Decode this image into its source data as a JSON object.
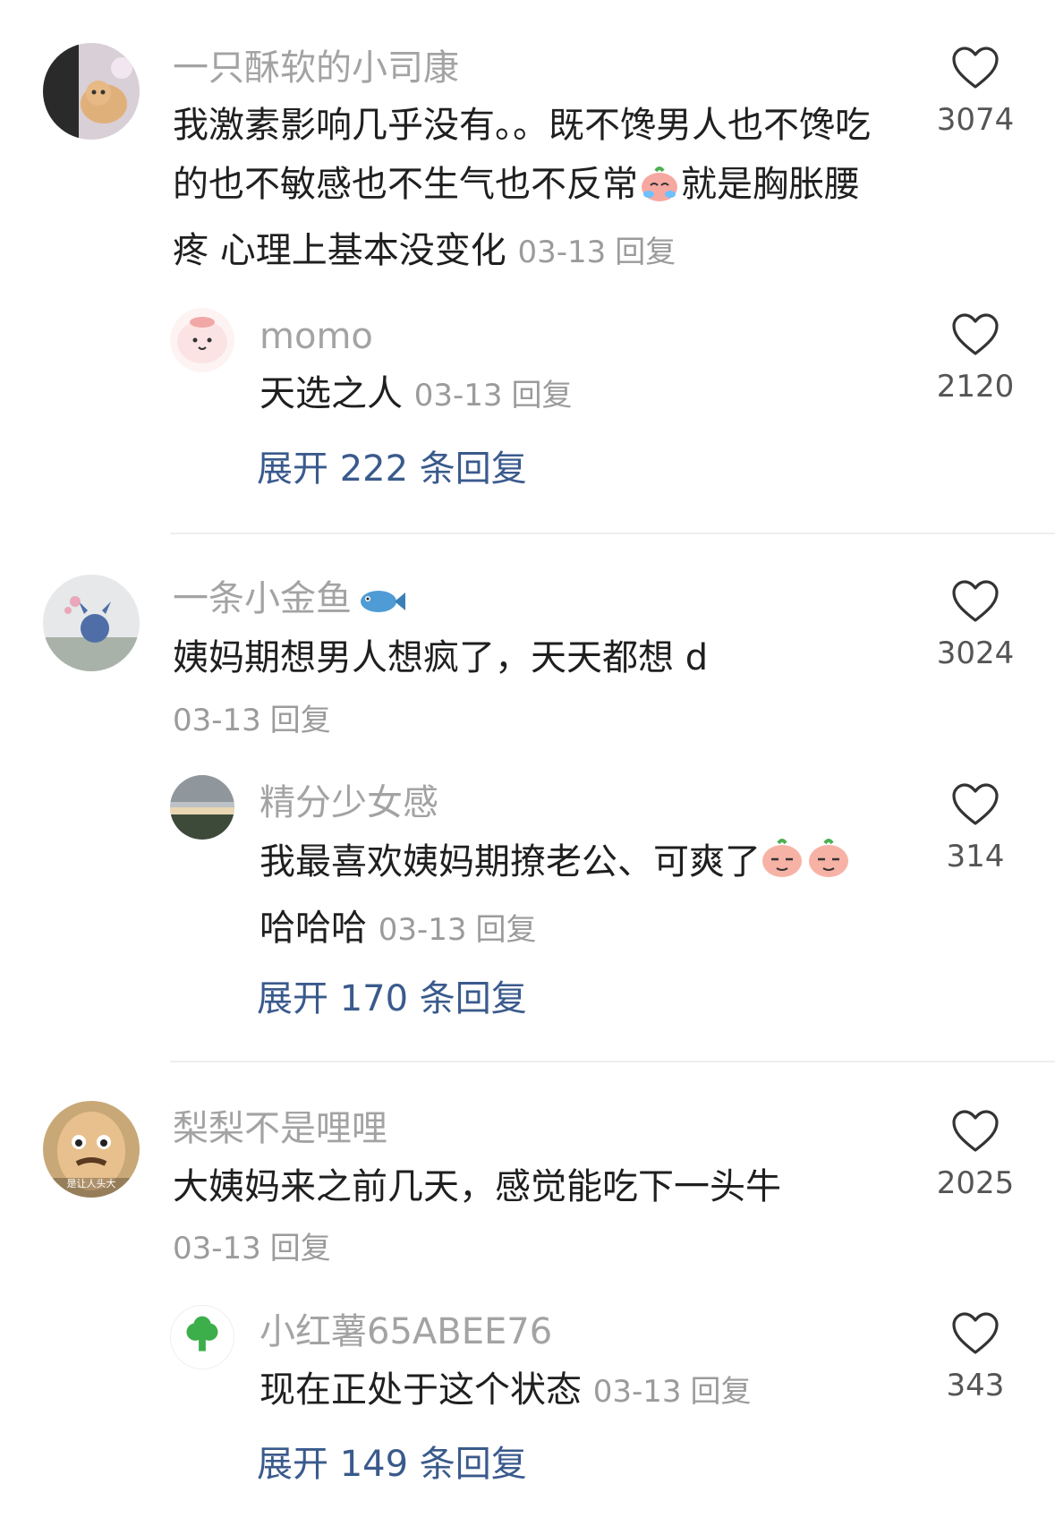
{
  "threads": [
    {
      "author": "一只酥软的小司康",
      "text_before_emoji": "我激素影响几乎没有。。既不馋男人也不馋吃的也不敏感也不生气也不反常",
      "emoji": "crying-peach-emoji",
      "text_after_emoji": "就是胸胀腰疼 心理上基本没变化",
      "date": "03-13",
      "reply_label": "回复",
      "likes": "3074",
      "reply": {
        "author": "momo",
        "text": "天选之人",
        "date": "03-13",
        "reply_label": "回复",
        "likes": "2120"
      },
      "expand_label": "展开 222 条回复"
    },
    {
      "author": "一条小金鱼",
      "author_emoji": "fish-emoji",
      "text": "姨妈期想男人想疯了，天天都想 d",
      "date": "03-13",
      "reply_label": "回复",
      "likes": "3024",
      "reply": {
        "author": "精分少女感",
        "text_before_emoji": "我最喜欢姨妈期撩老公、可爽了",
        "emoji": "smirk-peach-emoji",
        "text_after_emoji": "哈哈哈",
        "date": "03-13",
        "reply_label": "回复",
        "likes": "314"
      },
      "expand_label": "展开 170 条回复"
    },
    {
      "author": "梨梨不是哩哩",
      "avatar_text": "是让人头大",
      "text": "大姨妈来之前几天，感觉能吃下一头牛",
      "date": "03-13",
      "reply_label": "回复",
      "likes": "2025",
      "reply": {
        "author": "小红薯65ABEE76",
        "text": "现在正处于这个状态",
        "date": "03-13",
        "reply_label": "回复",
        "likes": "343"
      },
      "expand_label": "展开 149 条回复"
    }
  ],
  "colors": {
    "username": "#a3a3a3",
    "meta": "#9b9b9b",
    "expand_link": "#3a5a8c",
    "divider": "#eeeeee"
  }
}
